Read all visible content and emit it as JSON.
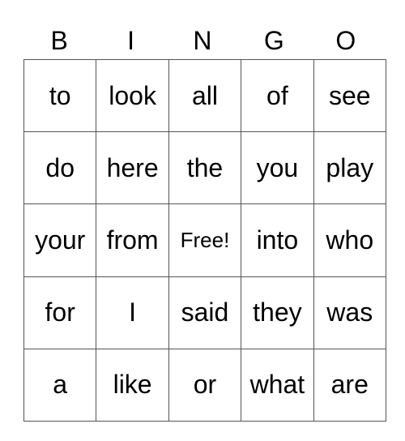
{
  "header": [
    "B",
    "I",
    "N",
    "G",
    "O"
  ],
  "rows": [
    [
      "to",
      "look",
      "all",
      "of",
      "see"
    ],
    [
      "do",
      "here",
      "the",
      "you",
      "play"
    ],
    [
      "your",
      "from",
      "Free!",
      "into",
      "who"
    ],
    [
      "for",
      "I",
      "said",
      "they",
      "was"
    ],
    [
      "a",
      "like",
      "or",
      "what",
      "are"
    ]
  ]
}
